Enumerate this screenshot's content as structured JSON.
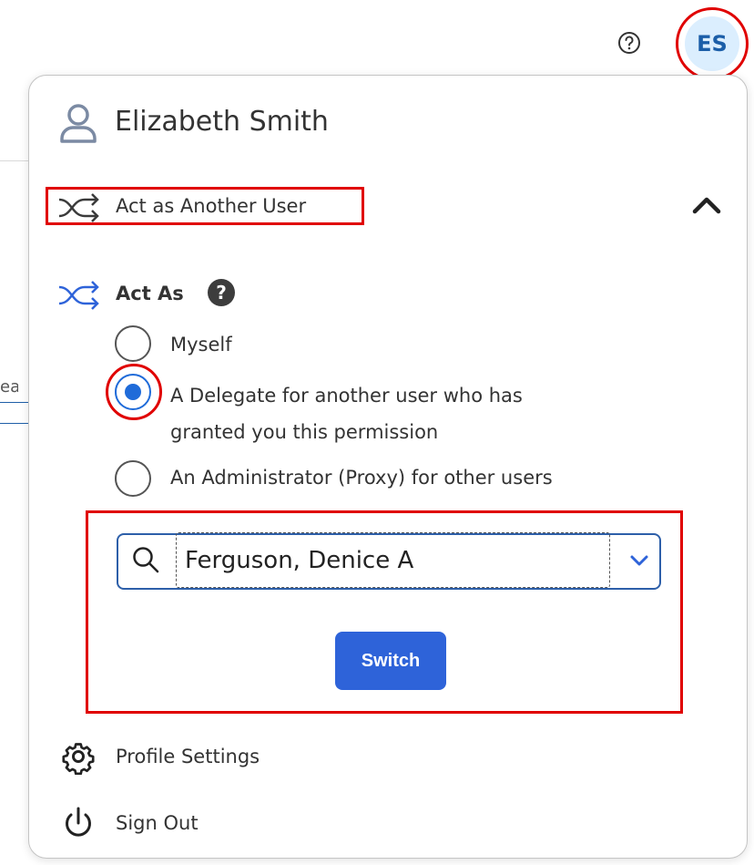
{
  "header": {
    "help_icon": "help-circle-icon",
    "avatar_initials": "ES"
  },
  "menu": {
    "user_name": "Elizabeth Smith",
    "act_as_another_user": "Act as Another User",
    "act_as": {
      "label": "Act As",
      "help_glyph": "?",
      "options": [
        {
          "label": "Myself",
          "selected": false
        },
        {
          "label": "A Delegate for another user who has granted you this permission",
          "selected": true
        },
        {
          "label": "An Administrator (Proxy) for other users",
          "selected": false
        }
      ]
    },
    "search": {
      "value": "Ferguson, Denice A",
      "icon": "search-icon"
    },
    "switch_label": "Switch",
    "profile_settings": "Profile Settings",
    "sign_out": "Sign Out"
  },
  "background": {
    "tab_fragment": "ea"
  },
  "colors": {
    "accent_blue": "#2e63d9",
    "highlight_red": "#e00000",
    "avatar_bg": "#dbeefe",
    "avatar_text": "#1b5ea8"
  }
}
